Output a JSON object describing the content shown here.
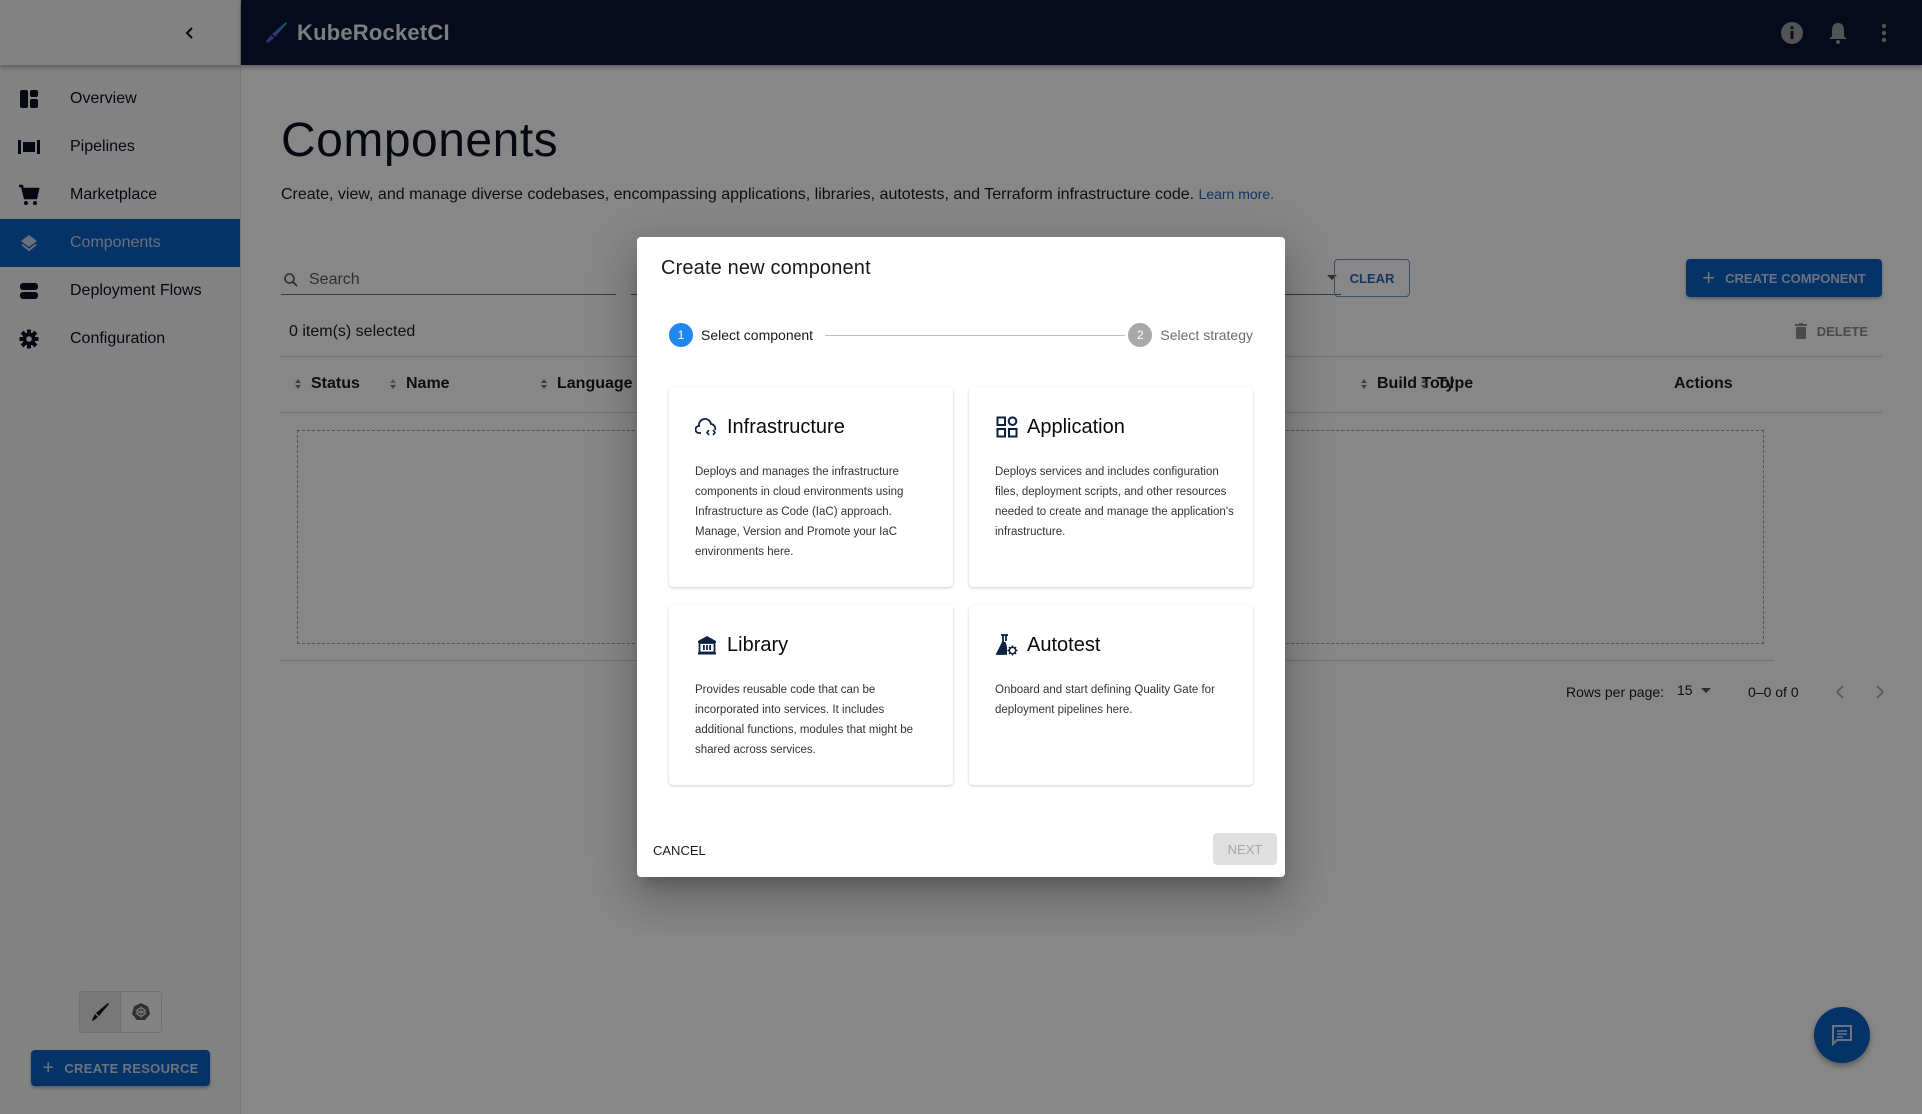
{
  "app": {
    "brand_name": "KubeRocketCI",
    "accent_color": "#0b5fbf",
    "topbar_color": "#0c1634"
  },
  "topbar": {
    "actions": [
      {
        "icon": "info-icon"
      },
      {
        "icon": "bell-icon"
      },
      {
        "icon": "more-vert-icon"
      }
    ]
  },
  "sidebar": {
    "collapse_icon": "chevron-left-icon",
    "items": [
      {
        "label": "Overview",
        "icon": "dashboard-icon",
        "active": false
      },
      {
        "label": "Pipelines",
        "icon": "pipelines-icon",
        "active": false
      },
      {
        "label": "Marketplace",
        "icon": "cart-icon",
        "active": false
      },
      {
        "label": "Components",
        "icon": "layers-icon",
        "active": true
      },
      {
        "label": "Deployment Flows",
        "icon": "deployment-flows-icon",
        "active": false
      },
      {
        "label": "Configuration",
        "icon": "gear-icon",
        "active": false
      }
    ],
    "mode_toggle": [
      {
        "icon": "rocket-icon",
        "selected": true
      },
      {
        "icon": "kubernetes-icon",
        "selected": false
      }
    ],
    "create_resource_label": "CREATE RESOURCE"
  },
  "main": {
    "title": "Components",
    "description": "Create, view, and manage diverse codebases, encompassing applications, libraries, autotests, and Terraform infrastructure code.",
    "learn_more": "Learn more.",
    "search_placeholder": "Search",
    "clear_label": "CLEAR",
    "create_component_label": "CREATE COMPONENT",
    "selected_count": "0 item(s) selected",
    "delete_label": "DELETE",
    "columns": [
      "Status",
      "Name",
      "Language",
      "Build Tool",
      "Type",
      "Actions"
    ],
    "pagination": {
      "rows_per_page_label": "Rows per page:",
      "rows_per_page": "15",
      "range": "0–0 of 0"
    }
  },
  "dialog": {
    "title": "Create new component",
    "steps": [
      {
        "number": "1",
        "label": "Select component",
        "active": true
      },
      {
        "number": "2",
        "label": "Select strategy",
        "active": false
      }
    ],
    "cards": [
      {
        "title": "Infrastructure",
        "icon": "cloud-code-icon",
        "description": "Deploys and manages the infrastructure components in cloud environments using Infrastructure as Code (IaC) approach. Manage, Version and Promote your IaC environments here."
      },
      {
        "title": "Application",
        "icon": "apps-grid-icon",
        "description": "Deploys services and includes configuration files, deployment scripts, and other resources needed to create and manage the application's infrastructure."
      },
      {
        "title": "Library",
        "icon": "library-icon",
        "description": "Provides reusable code that can be incorporated into services. It includes additional functions, modules that might be shared across services."
      },
      {
        "title": "Autotest",
        "icon": "flask-gear-icon",
        "description": "Onboard and start defining Quality Gate for deployment pipelines here."
      }
    ],
    "cancel_label": "CANCEL",
    "next_label": "NEXT"
  }
}
